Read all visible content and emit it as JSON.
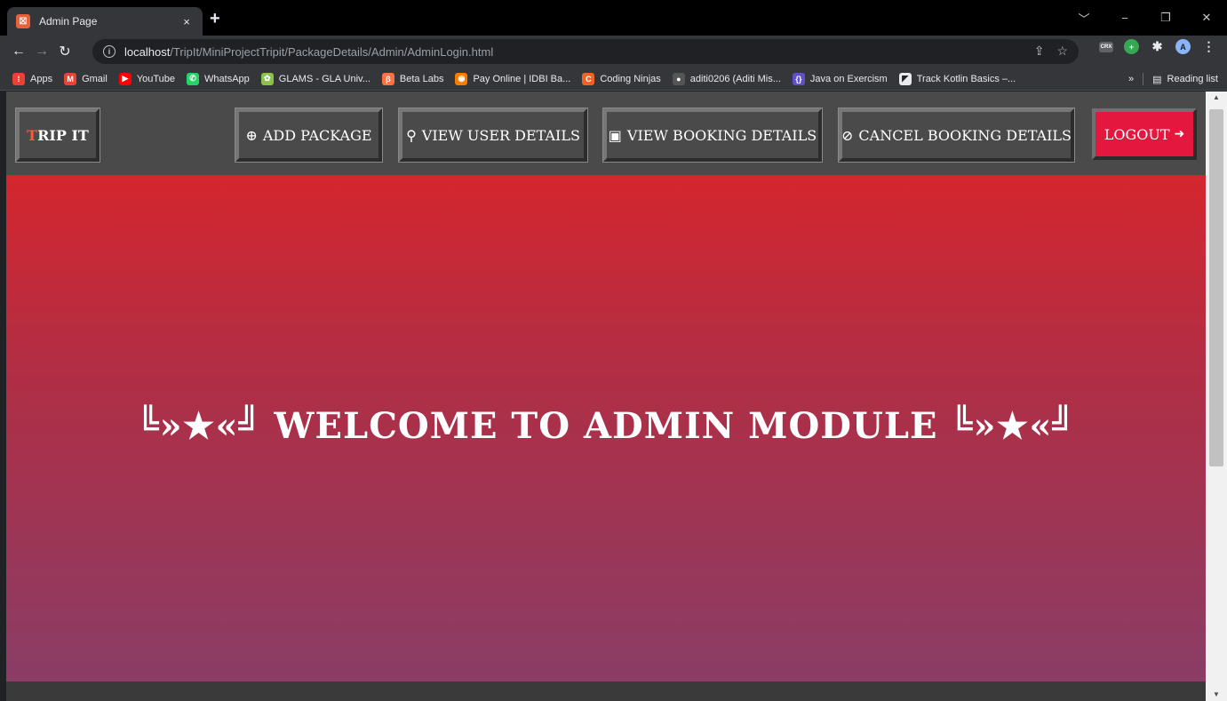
{
  "browser": {
    "tab_title": "Admin Page",
    "tab_close": "×",
    "new_tab": "+",
    "url_host": "localhost",
    "url_path": "/TripIt/MiniProjectTripit/PackageDetails/Admin/AdminLogin.html",
    "window_controls": {
      "tabs": "﹀",
      "minimize": "−",
      "restore": "❐",
      "close": "✕"
    },
    "profile_initial": "A",
    "bookmarks": [
      {
        "label": "Apps",
        "icon": "apps-grid-icon",
        "color": "#e94235"
      },
      {
        "label": "Gmail",
        "icon": "gmail-icon",
        "color": "#ea4335"
      },
      {
        "label": "YouTube",
        "icon": "youtube-icon",
        "color": "#ff0000"
      },
      {
        "label": "WhatsApp",
        "icon": "whatsapp-icon",
        "color": "#25d366"
      },
      {
        "label": "GLAMS - GLA Univ...",
        "icon": "glams-icon",
        "color": "#8bc34a"
      },
      {
        "label": "Beta Labs",
        "icon": "beta-labs-icon",
        "color": "#ff7043"
      },
      {
        "label": "Pay Online | IDBI Ba...",
        "icon": "idbi-icon",
        "color": "#f57c00"
      },
      {
        "label": "Coding Ninjas",
        "icon": "coding-ninjas-icon",
        "color": "#f06423"
      },
      {
        "label": "aditi0206 (Aditi Mis...",
        "icon": "github-icon",
        "color": "#555555"
      },
      {
        "label": "Java on Exercism",
        "icon": "exercism-icon",
        "color": "#604fcd"
      },
      {
        "label": "Track Kotlin Basics –...",
        "icon": "kotlin-icon",
        "color": "#e8eaed"
      }
    ],
    "bookmarks_overflow": "»",
    "reading_list": "Reading list"
  },
  "navbar": {
    "brand_first": "T",
    "brand_rest": "RIP IT",
    "items": [
      {
        "label": "ADD PACKAGE",
        "icon": "plus-circle-icon",
        "glyph": "⊕"
      },
      {
        "label": "VIEW USER DETAILS",
        "icon": "user-icon",
        "glyph": "⚲"
      },
      {
        "label": "VIEW BOOKING DETAILS",
        "icon": "address-book-icon",
        "glyph": "▣"
      },
      {
        "label": "CANCEL BOOKING DETAILS",
        "icon": "ban-icon",
        "glyph": "⊘"
      }
    ],
    "logout_label": "LOGOUT",
    "logout_glyph": "➜"
  },
  "hero": {
    "title": "╚»★«╝ WELCOME TO ADMIN MODULE ╚»★«╝"
  },
  "colors": {
    "brand_accent": "#ff5a36",
    "logout_bg": "#e4173f",
    "navbar_bg": "#4a4a4a",
    "hero_top": "#d4262e",
    "hero_bottom": "#8a3d66"
  }
}
